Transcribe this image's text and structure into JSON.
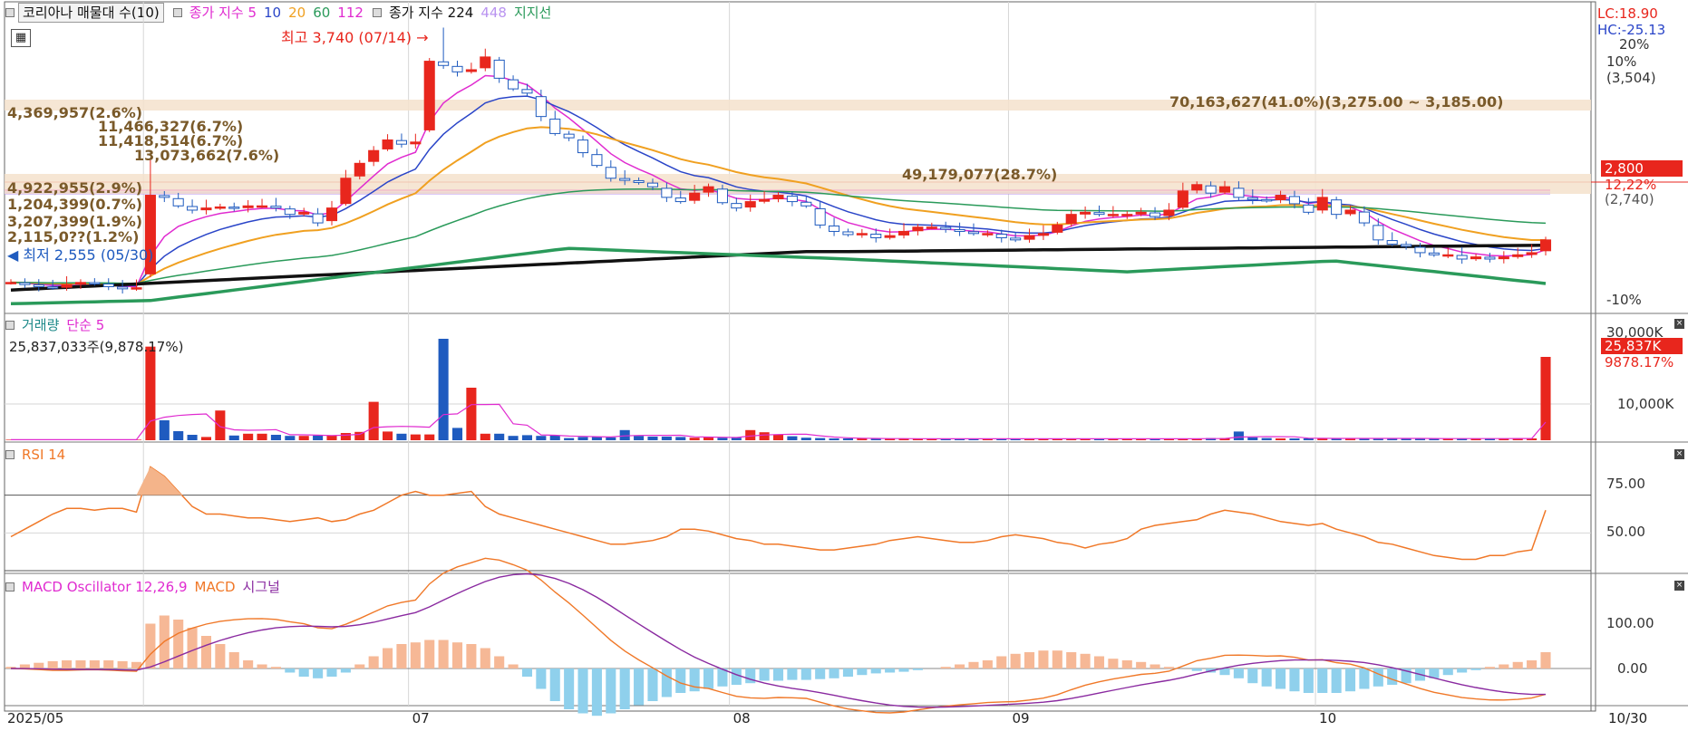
{
  "legend_main": {
    "title": "코리아나 매물대 수(10)",
    "ma_label": "종가 지수 5",
    "ma10": "10",
    "ma20": "20",
    "ma60": "60",
    "ma112": "112",
    "ma224_label": "종가 지수 224",
    "ma448": "448",
    "support": "지지선"
  },
  "annotations": {
    "high": "최고 3,740 (07/14)",
    "low": "최저 2,555 (05/30)",
    "lc": "LC:18.90",
    "hc": "HC:-25.13",
    "current_price": "2,800",
    "current_pct": "12,22%",
    "prev_price": "(2,740)"
  },
  "main_axis": [
    "20%",
    "10%",
    "(3,504)",
    "-10%"
  ],
  "volume_profile": [
    {
      "label": "4,369,957(2.6%)"
    },
    {
      "label": "11,466,327(6.7%)"
    },
    {
      "label": "11,418,514(6.7%)"
    },
    {
      "label": "13,073,662(7.6%)"
    },
    {
      "label": "49,179,077(28.7%)"
    },
    {
      "label": "70,163,627(41.0%)(3,275.00 ~ 3,185.00)"
    },
    {
      "label": "4,922,955(2.9%)"
    },
    {
      "label": "1,204,399(0.7%)"
    },
    {
      "label": "3,207,399(1.9%)"
    },
    {
      "label": "2,115,0??(1.2%)"
    }
  ],
  "legend_volume": {
    "label": "거래량",
    "ma": "단순 5"
  },
  "volume_info": "25,837,033주(9,878.17%)",
  "volume_axis": [
    "30,000K",
    "10,000K"
  ],
  "volume_tags": {
    "value": "25,837K",
    "pct": "9878.17%"
  },
  "legend_rsi": {
    "label": "RSI 14"
  },
  "rsi_axis": [
    "75.00",
    "50.00"
  ],
  "legend_macd": {
    "osc": "MACD Oscillator 12,26,9",
    "macd": "MACD",
    "signal": "시그널"
  },
  "macd_axis": [
    "100.00",
    "0.00"
  ],
  "x_axis": [
    "2025/05",
    "07",
    "08",
    "09",
    "10",
    "10/30"
  ],
  "colors": {
    "up": "#e8261d",
    "down": "#1f5bbf",
    "ma5": "#e02bd0",
    "ma10": "#2a45c8",
    "ma20": "#f0a020",
    "ma60": "#2a9a5a",
    "ma112": "#e02bd0",
    "ma224": "#111111",
    "ma448": "#b993f0",
    "rsi": "#f07828",
    "macd": "#f07828",
    "signal": "#8a2aa0"
  },
  "chart_data": {
    "type": "candlestick",
    "dates": [
      "05/19",
      "05/20",
      "05/21",
      "05/22",
      "05/23",
      "05/26",
      "05/27",
      "05/28",
      "05/29",
      "05/30",
      "06/02",
      "06/04",
      "06/05",
      "06/09",
      "06/10",
      "06/11",
      "06/12",
      "06/13",
      "06/16",
      "06/17",
      "06/18",
      "06/19",
      "06/20",
      "06/23",
      "06/24",
      "06/25",
      "06/26",
      "06/27",
      "06/30",
      "07/01",
      "07/02",
      "07/03",
      "07/04",
      "07/07",
      "07/08",
      "07/09",
      "07/10",
      "07/11",
      "07/14",
      "07/15",
      "07/16",
      "07/17",
      "07/18",
      "07/21",
      "07/22",
      "07/23",
      "07/24",
      "07/25",
      "07/28",
      "07/29",
      "07/30",
      "07/31",
      "08/01",
      "08/04",
      "08/05",
      "08/06",
      "08/07",
      "08/08",
      "08/11",
      "08/12",
      "08/13",
      "08/14",
      "08/18",
      "08/19",
      "08/20",
      "08/21",
      "08/22",
      "08/25",
      "08/26",
      "08/27",
      "08/28",
      "08/29",
      "09/01",
      "09/02",
      "09/03",
      "09/04",
      "09/05",
      "09/08",
      "09/09",
      "09/10",
      "09/11",
      "09/12",
      "09/15",
      "09/16",
      "09/17",
      "09/18",
      "09/19",
      "09/22",
      "09/23",
      "09/24",
      "09/25",
      "09/26",
      "09/29",
      "09/30",
      "10/01",
      "10/02",
      "10/10",
      "10/13",
      "10/14",
      "10/15",
      "10/16",
      "10/17",
      "10/20",
      "10/21",
      "10/22",
      "10/23",
      "10/24",
      "10/27",
      "10/28",
      "10/29",
      "10/30"
    ],
    "close": [
      2600,
      2590,
      2580,
      2575,
      2590,
      2600,
      2595,
      2580,
      2570,
      2575,
      3010,
      3000,
      2960,
      2940,
      2950,
      2955,
      2950,
      2960,
      2960,
      2950,
      2920,
      2930,
      2880,
      2950,
      3090,
      3160,
      3220,
      3270,
      3250,
      3260,
      3640,
      3620,
      3590,
      3600,
      3660,
      3560,
      3510,
      3490,
      3380,
      3300,
      3280,
      3210,
      3150,
      3090,
      3080,
      3070,
      3050,
      3000,
      2980,
      3020,
      3050,
      2975,
      2950,
      2980,
      2990,
      3010,
      2980,
      2960,
      2870,
      2840,
      2825,
      2830,
      2810,
      2820,
      2840,
      2860,
      2860,
      2850,
      2840,
      2830,
      2830,
      2810,
      2800,
      2820,
      2830,
      2870,
      2920,
      2930,
      2920,
      2920,
      2920,
      2930,
      2910,
      2940,
      3030,
      3060,
      3020,
      3050,
      3000,
      2990,
      2985,
      3010,
      2970,
      2930,
      3000,
      2920,
      2940,
      2880,
      2800,
      2780,
      2770,
      2740,
      2730,
      2730,
      2710,
      2720,
      2710,
      2720,
      2730,
      2740,
      2800
    ],
    "volume_k": [
      150,
      150,
      150,
      150,
      150,
      150,
      150,
      150,
      150,
      150,
      25837,
      5500,
      2500,
      1500,
      900,
      8200,
      1300,
      1800,
      1800,
      1500,
      1200,
      1200,
      1300,
      1300,
      2000,
      2300,
      10600,
      2400,
      1800,
      1600,
      1600,
      28000,
      3400,
      14500,
      1800,
      1800,
      1200,
      1400,
      1200,
      1300,
      600,
      900,
      900,
      800,
      2800,
      1200,
      1000,
      1000,
      900,
      700,
      800,
      700,
      700,
      2800,
      2200,
      1500,
      1100,
      700,
      600,
      500,
      500,
      500,
      400,
      400,
      400,
      400,
      400,
      400,
      400,
      400,
      400,
      400,
      400,
      400,
      400,
      400,
      400,
      400,
      400,
      400,
      400,
      400,
      400,
      400,
      400,
      400,
      600,
      600,
      2400,
      800,
      600,
      500,
      500,
      500,
      500,
      500,
      500,
      500,
      500,
      500,
      500,
      500,
      400,
      400,
      500,
      400,
      500,
      500,
      500,
      500,
      23000
    ],
    "rsi": [
      48,
      52,
      56,
      60,
      63,
      63,
      62,
      63,
      63,
      61,
      85,
      80,
      72,
      64,
      60,
      60,
      59,
      58,
      58,
      57,
      56,
      57,
      58,
      56,
      57,
      60,
      62,
      66,
      70,
      72,
      70,
      70,
      71,
      72,
      64,
      60,
      58,
      56,
      54,
      52,
      50,
      48,
      46,
      44,
      44,
      45,
      46,
      48,
      52,
      52,
      51,
      49,
      47,
      46,
      44,
      44,
      43,
      42,
      41,
      41,
      42,
      43,
      44,
      46,
      47,
      48,
      47,
      46,
      45,
      45,
      46,
      48,
      49,
      48,
      47,
      45,
      44,
      42,
      44,
      45,
      47,
      52,
      54,
      55,
      56,
      57,
      60,
      62,
      61,
      60,
      58,
      56,
      55,
      54,
      55,
      52,
      50,
      48,
      45,
      44,
      42,
      40,
      38,
      37,
      36,
      36,
      38,
      38,
      40,
      41,
      62
    ],
    "macd_osc": [
      2,
      5,
      7,
      9,
      10,
      10,
      10,
      10,
      9,
      8,
      55,
      65,
      60,
      50,
      40,
      30,
      20,
      10,
      5,
      2,
      -5,
      -10,
      -12,
      -10,
      -5,
      5,
      15,
      25,
      30,
      32,
      35,
      35,
      32,
      30,
      25,
      15,
      5,
      -10,
      -25,
      -40,
      -50,
      -55,
      -58,
      -55,
      -50,
      -45,
      -40,
      -35,
      -30,
      -28,
      -25,
      -22,
      -20,
      -18,
      -15,
      -15,
      -14,
      -14,
      -13,
      -12,
      -10,
      -8,
      -6,
      -5,
      -4,
      -2,
      0,
      2,
      5,
      8,
      10,
      15,
      18,
      20,
      22,
      22,
      20,
      18,
      15,
      12,
      10,
      8,
      5,
      2,
      0,
      -3,
      -5,
      -8,
      -12,
      -18,
      -22,
      -25,
      -28,
      -30,
      -30,
      -30,
      -28,
      -25,
      -22,
      -20,
      -18,
      -15,
      -12,
      -8,
      -5,
      -2,
      2,
      5,
      8,
      10,
      20
    ],
    "ylim_price": [
      2480,
      3800
    ]
  }
}
